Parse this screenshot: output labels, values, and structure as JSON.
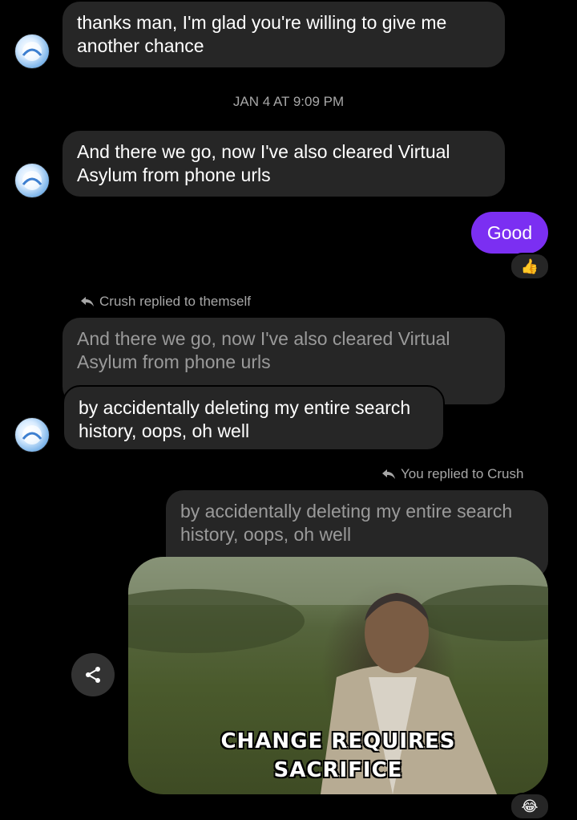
{
  "messages": {
    "m1": {
      "text": "thanks man, I'm glad you're willing to give me another chance"
    },
    "timestamp": "JAN 4 AT 9:09 PM",
    "m2": {
      "text": "And there we go, now I've also cleared Virtual Asylum from phone urls"
    },
    "m3": {
      "text": "Good",
      "reaction": "👍"
    },
    "reply1": {
      "label": "Crush replied to themself",
      "quoted": "And there we go, now I've also cleared Virtual Asylum from phone urls",
      "text": "by accidentally deleting my entire search history, oops, oh well"
    },
    "reply2": {
      "label": "You replied to Crush",
      "quoted": "by accidentally deleting my entire search history, oops, oh well",
      "gif_caption_line1": "CHANGE REQUIRES",
      "gif_caption_line2": "SACRIFICE",
      "reaction": "😂"
    }
  },
  "colors": {
    "background": "#000000",
    "incoming_bubble": "#262626",
    "outgoing_bubble": "#7b2ff2",
    "muted_text": "#a7a7a7"
  },
  "icons": [
    "avatar",
    "reply-arrow-icon",
    "share-icon"
  ]
}
